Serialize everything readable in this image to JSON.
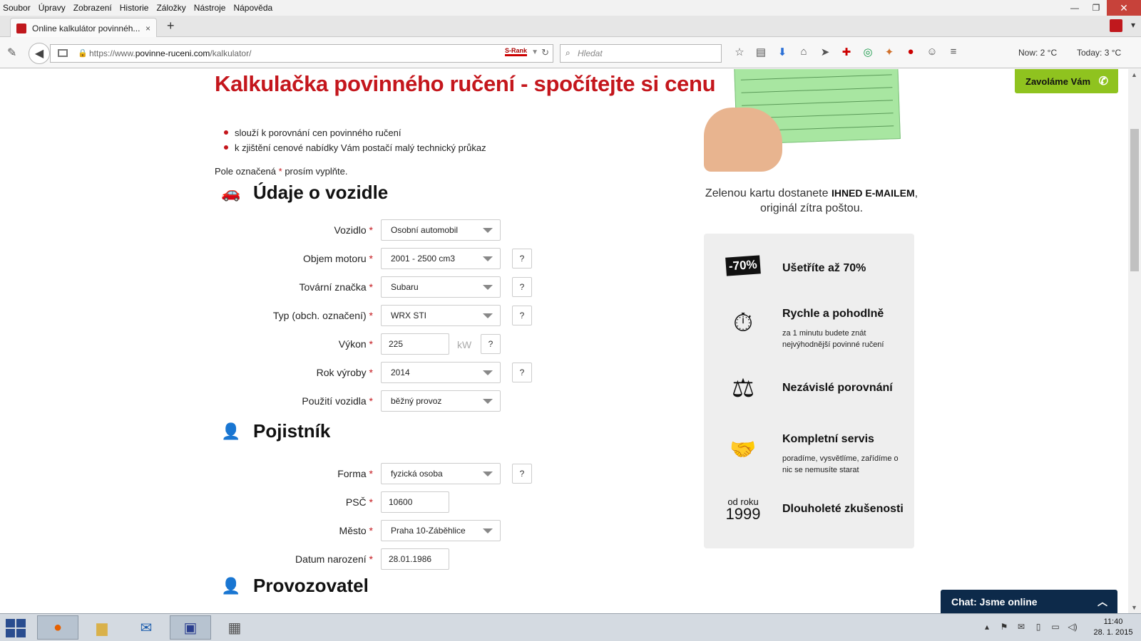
{
  "menubar": [
    "Soubor",
    "Úpravy",
    "Zobrazení",
    "Historie",
    "Záložky",
    "Nástroje",
    "Nápověda"
  ],
  "tab": {
    "title": "Online kalkulátor povinnéh...",
    "close": "×",
    "new": "+"
  },
  "address": {
    "prefix": "https://www.",
    "host": "povinne-ruceni.com",
    "path": "/kalkulator/",
    "srank": "S-Rank"
  },
  "search": {
    "placeholder": "Hledat"
  },
  "weather": {
    "now": "Now: 2 °C",
    "today": "Today: 3 °C"
  },
  "page": {
    "title": "Kalkulačka povinného ručení - spočítejte si cenu",
    "bullets": [
      "slouží k porovnání cen povinného ručení",
      "k zjištění cenové nabídky Vám postačí malý technický průkaz"
    ],
    "required_note_before": "Pole označená",
    "required_star": "*",
    "required_note_after": "prosím vyplňte.",
    "help_mark": "?",
    "vehicle_section": {
      "heading": "Údaje o vozidle",
      "fields": [
        {
          "label": "Vozidlo",
          "value": "Osobní automobil"
        },
        {
          "label": "Objem motoru",
          "value": "2001 - 2500 cm3"
        },
        {
          "label": "Tovární značka",
          "value": "Subaru"
        },
        {
          "label": "Typ (obch. označení)",
          "value": "WRX STI"
        },
        {
          "label": "Výkon",
          "value": "225",
          "unit": "kW"
        },
        {
          "label": "Rok výroby",
          "value": "2014"
        },
        {
          "label": "Použití vozidla",
          "value": "běžný provoz"
        }
      ]
    },
    "policyholder_section": {
      "heading": "Pojistník",
      "fields": [
        {
          "label": "Forma",
          "value": "fyzická osoba"
        },
        {
          "label": "PSČ",
          "value": "10600"
        },
        {
          "label": "Město",
          "value": "Praha 10-Záběhlice"
        },
        {
          "label": "Datum narození",
          "value": "28.01.1986"
        }
      ]
    },
    "operator_section": {
      "heading": "Provozovatel"
    },
    "card_text": {
      "before": "Zelenou kartu dostanete",
      "bold": "IHNED E-MAILEM",
      "after": ",",
      "line2": "originál zítra poštou."
    },
    "benefits": [
      {
        "badge": "-70%",
        "title": "Ušetříte až 70%"
      },
      {
        "title": "Rychle a pohodlně",
        "sub": "za 1 minutu budete znát nejvýhodnější povinné ručení"
      },
      {
        "title": "Nezávislé porovnání"
      },
      {
        "title": "Kompletní servis",
        "sub": "poradíme, vysvětlíme, zařídíme o nic se nemusíte starat"
      },
      {
        "since": "od roku",
        "year": "1999",
        "title": "Dlouholeté zkušenosti"
      }
    ],
    "call_button": "Zavoláme Vám",
    "chat": "Chat: Jsme online"
  },
  "taskbar": {
    "time": "11:40",
    "date": "28. 1. 2015"
  },
  "colors": {
    "brand_red": "#c4161c",
    "call_green": "#8fc31f",
    "chat_navy": "#0d2a4a"
  },
  "icons": [
    "back-arrow-icon",
    "lock-icon",
    "reload-icon",
    "search-icon",
    "star-icon",
    "reading-list-icon",
    "download-icon",
    "home-icon",
    "send-icon",
    "uk-flag-icon",
    "menu-icon",
    "car-icon",
    "person-icon",
    "person-plus-icon",
    "stopwatch-icon",
    "scales-icon",
    "handshake-icon",
    "phone-icon",
    "chevron-up-icon"
  ]
}
